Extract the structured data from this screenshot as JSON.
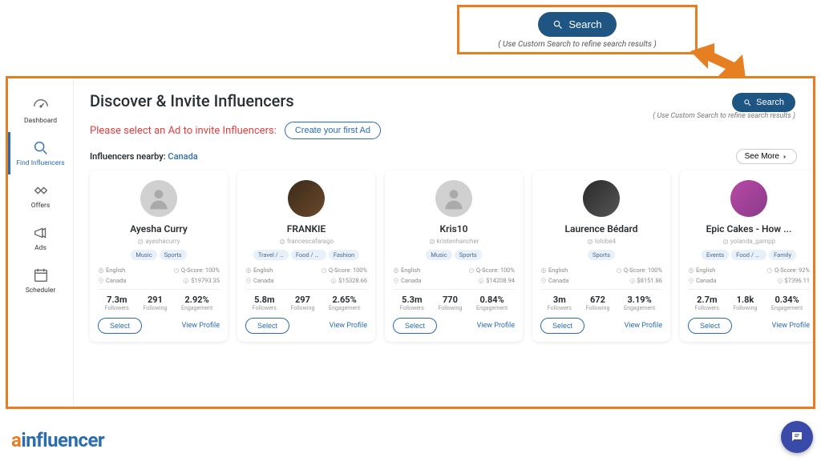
{
  "callout": {
    "search": "Search",
    "hint": "( Use Custom Search to refine search results )"
  },
  "sidebar": {
    "items": [
      {
        "label": "Dashboard"
      },
      {
        "label": "Find Influencers"
      },
      {
        "label": "Offers"
      },
      {
        "label": "Ads"
      },
      {
        "label": "Scheduler"
      }
    ]
  },
  "header": {
    "title": "Discover & Invite Influencers",
    "search": "Search",
    "hint": "( Use Custom Search to refine search results )"
  },
  "prompt": {
    "text": "Please select an Ad to invite Influencers:",
    "cta": "Create your first Ad"
  },
  "nearby": {
    "label": "Influencers nearby: ",
    "location": "Canada",
    "see_more": "See More"
  },
  "labels": {
    "followers": "Followers",
    "following": "Following",
    "engagement": "Engagement",
    "select": "Select",
    "view": "View Profile"
  },
  "cards": [
    {
      "name": "Ayesha Curry",
      "handle": "ayeshacurry",
      "avatar": "placeholder",
      "tags": [
        "Music",
        "Sports"
      ],
      "lang": "English",
      "qscore": "Q-Score: 100%",
      "country": "Canada",
      "price": "$19793.35",
      "followers": "7.3m",
      "following": "291",
      "engagement": "2.92%"
    },
    {
      "name": "FRANKIE",
      "handle": "francescafarago",
      "avatar": "img1",
      "tags": [
        "Travel / ...",
        "Food / Di...",
        "Fashion"
      ],
      "lang": "English",
      "qscore": "Q-Score: 100%",
      "country": "Canada",
      "price": "$15328.66",
      "followers": "5.8m",
      "following": "297",
      "engagement": "2.65%"
    },
    {
      "name": "Kris10",
      "handle": "kristenhancher",
      "avatar": "placeholder",
      "tags": [
        "Music",
        "Sports"
      ],
      "lang": "English",
      "qscore": "Q-Score: 100%",
      "country": "Canada",
      "price": "$14208.94",
      "followers": "5.3m",
      "following": "770",
      "engagement": "0.84%"
    },
    {
      "name": "Laurence Bédard",
      "handle": "lolobe4",
      "avatar": "img2",
      "tags": [
        "Sports"
      ],
      "lang": "English",
      "qscore": "Q-Score: 100%",
      "country": "Canada",
      "price": "$8151.86",
      "followers": "3m",
      "following": "672",
      "engagement": "3.19%"
    },
    {
      "name": "Epic Cakes - How ...",
      "handle": "yolanda_gampp",
      "avatar": "img3",
      "tags": [
        "Events",
        "Food / Di...",
        "Family"
      ],
      "lang": "English",
      "qscore": "Q-Score: 92%",
      "country": "Canada",
      "price": "$7396.11",
      "followers": "2.7m",
      "following": "1.8k",
      "engagement": "0.34%"
    }
  ],
  "logo": {
    "a": "a",
    "rest": "influencer"
  }
}
